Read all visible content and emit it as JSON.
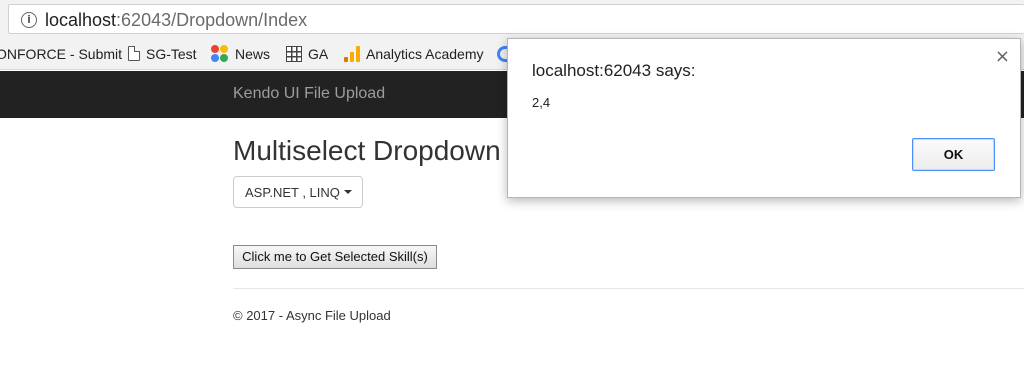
{
  "browser": {
    "url_host": "localhost",
    "url_rest": ":62043/Dropdown/Index",
    "bookmarks": [
      {
        "label": "ONFORCE - Submit",
        "icon": "none"
      },
      {
        "label": "SG-Test",
        "icon": "page-icon"
      },
      {
        "label": "News",
        "icon": "flower-icon"
      },
      {
        "label": "GA",
        "icon": "grid-icon"
      },
      {
        "label": "Analytics Academy",
        "icon": "bar-chart-icon"
      },
      {
        "label": "",
        "icon": "partial-icon"
      }
    ]
  },
  "navbar": {
    "brand": "Kendo UI File Upload"
  },
  "main": {
    "title": "Multiselect Dropdown",
    "dropdown_value": "ASP.NET , LINQ",
    "get_button_label": "Click me to Get Selected Skill(s)"
  },
  "footer": {
    "text": "© 2017 - Async File Upload"
  },
  "dialog": {
    "title": "localhost:62043 says:",
    "message": "2,4",
    "ok_label": "OK",
    "close_glyph": "×"
  },
  "colors": {
    "navbar_bg": "#222222",
    "brand_text": "#9d9d9d",
    "focus_blue": "#4d90fe"
  }
}
